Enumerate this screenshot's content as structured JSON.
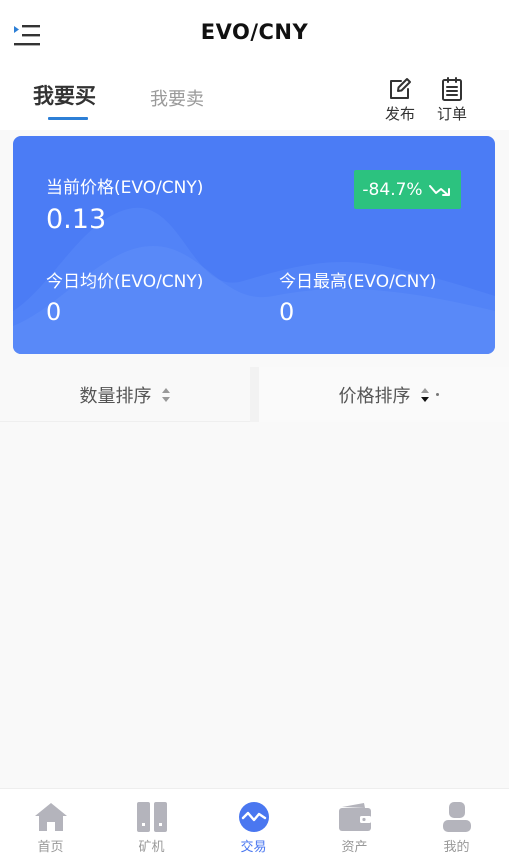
{
  "header": {
    "title": "EVO/CNY"
  },
  "tabs": [
    {
      "label": "我要买"
    },
    {
      "label": "我要卖"
    }
  ],
  "actions": {
    "publish": "发布",
    "orders": "订单"
  },
  "price_card": {
    "current_label": "当前价格(EVO/CNY)",
    "current_value": "0.13",
    "change": "-84.7%",
    "avg_label": "今日均价(EVO/CNY)",
    "avg_value": "0",
    "high_label": "今日最高(EVO/CNY)",
    "high_value": "0",
    "colors": {
      "card": "#4b7cf5",
      "badge": "#2cc27f"
    }
  },
  "sort": {
    "quantity": "数量排序",
    "price": "价格排序"
  },
  "bottom_nav": [
    {
      "label": "首页",
      "icon": "home-icon"
    },
    {
      "label": "矿机",
      "icon": "miner-icon"
    },
    {
      "label": "交易",
      "icon": "trade-icon"
    },
    {
      "label": "资产",
      "icon": "wallet-icon"
    },
    {
      "label": "我的",
      "icon": "user-icon"
    }
  ],
  "accent": "#4a77f0"
}
